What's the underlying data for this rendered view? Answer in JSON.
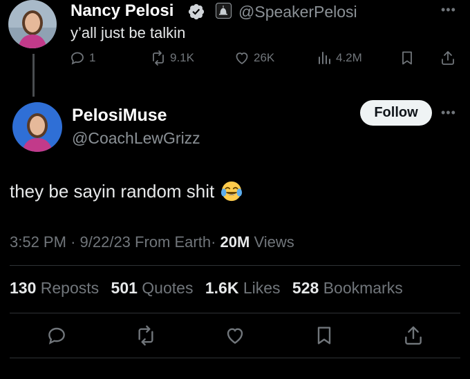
{
  "parent_tweet": {
    "display_name": "Nancy Pelosi",
    "handle": "@SpeakerPelosi",
    "text": "y’all just be talkin",
    "more_icon": "ellipsis-icon",
    "stats": {
      "replies": "1",
      "reposts": "9.1K",
      "likes": "26K",
      "views": "4.2M"
    }
  },
  "main_tweet": {
    "display_name": "PelosiMuse",
    "handle": "@CoachLewGrizz",
    "follow_label": "Follow",
    "text": "they be sayin random shit",
    "emoji": "face-with-tears-of-joy",
    "meta": {
      "time": "3:52 PM",
      "separator": "·",
      "date": "9/22/23",
      "location": "From Earth",
      "views_count": "20M",
      "views_label": "Views"
    },
    "engagement": {
      "reposts_count": "130",
      "reposts_label": "Reposts",
      "quotes_count": "501",
      "quotes_label": "Quotes",
      "likes_count": "1.6K",
      "likes_label": "Likes",
      "bookmarks_count": "528",
      "bookmarks_label": "Bookmarks"
    }
  },
  "colors": {
    "background": "#000000",
    "primary_text": "#e7e9ea",
    "secondary_text": "#71767b",
    "verified_blue": "#1d9bf0",
    "follow_button_bg": "#eff3f4",
    "divider": "#2f3336"
  }
}
